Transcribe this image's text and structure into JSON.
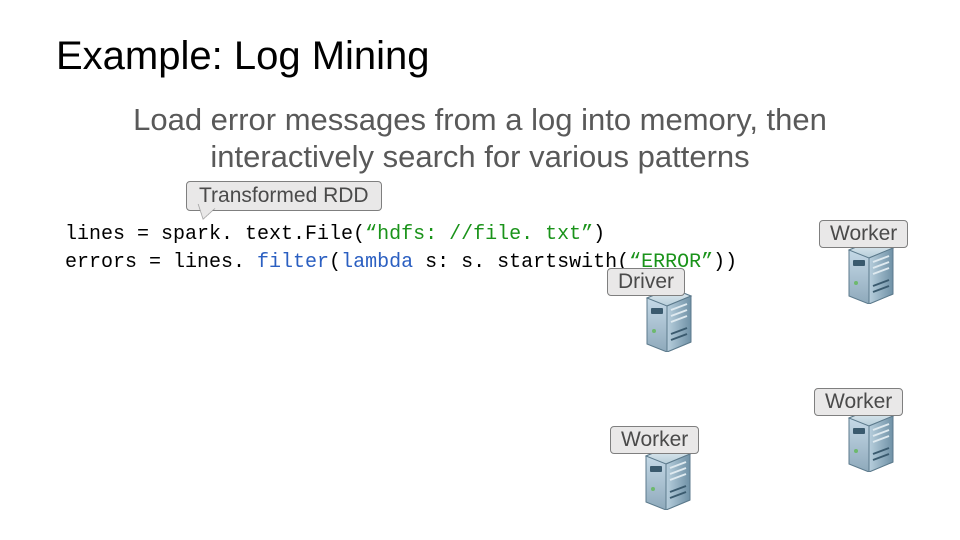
{
  "title": "Example: Log Mining",
  "subtitle": "Load error messages from a a log into memory, then interactively search for various patterns",
  "subtitle_line1": "Load error messages from a log into memory, then",
  "subtitle_line2": "interactively search for various patterns",
  "callouts": {
    "transformed": "Transformed RDD"
  },
  "code": {
    "l1_a": "lines = spark. text.",
    "l1_b": "File(",
    "l1_c": "“hdfs: //file. txt”",
    "l1_d": ")",
    "l2_a": "errors = lines. ",
    "l2_b": "filter",
    "l2_c": "(",
    "l2_d": "lambda",
    "l2_e": " s: s. startswith(",
    "l2_f": "“ERROR”",
    "l2_g": "))"
  },
  "nodes": {
    "driver": "Driver",
    "worker1": "Worker",
    "worker2": "Worker",
    "worker3": "Worker"
  },
  "icons": {
    "server": "server-icon"
  }
}
